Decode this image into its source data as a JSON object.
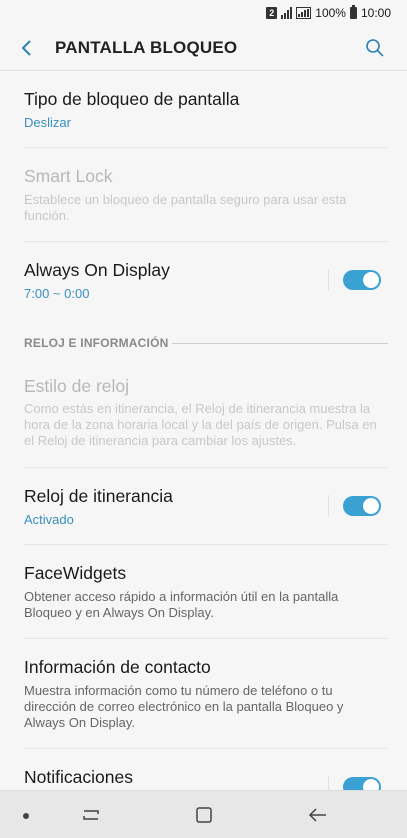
{
  "status": {
    "sim": "2",
    "battery": "100%",
    "time": "10:00"
  },
  "header": {
    "title": "PANTALLA BLOQUEO"
  },
  "items": {
    "lock_type": {
      "title": "Tipo de bloqueo de pantalla",
      "value": "Deslizar"
    },
    "smart_lock": {
      "title": "Smart Lock",
      "desc": "Establece un bloqueo de pantalla seguro para usar esta función."
    },
    "always_on": {
      "title": "Always On Display",
      "value": "7:00 ~ 0:00",
      "enabled": true
    },
    "section_clock": "RELOJ E INFORMACIÓN",
    "clock_style": {
      "title": "Estilo de reloj",
      "desc": "Como estás en itinerancia, el Reloj de itinerancia muestra la hora de la zona horaria local y la del país de origen. Pulsa en el Reloj de itinerancia para cambiar los ajustes."
    },
    "roaming_clock": {
      "title": "Reloj de itinerancia",
      "value": "Activado",
      "enabled": true
    },
    "facewidgets": {
      "title": "FaceWidgets",
      "desc": "Obtener acceso rápido a información útil en la pantalla Bloqueo y en Always On Display."
    },
    "contact_info": {
      "title": "Información de contacto",
      "desc": "Muestra información como tu número de teléfono o tu dirección de correo electrónico en la pantalla Bloqueo y Always On Display."
    },
    "notifications": {
      "title": "Notificaciones",
      "enabled": true
    }
  },
  "colors": {
    "accent": "#3aa1d3",
    "value_text": "#3a8fc0",
    "background": "#f6f6f6"
  },
  "icons": {
    "back": "back-arrow-icon",
    "search": "search-icon",
    "recent": "recent-apps-icon",
    "home": "home-icon",
    "nav_back": "nav-back-icon"
  }
}
